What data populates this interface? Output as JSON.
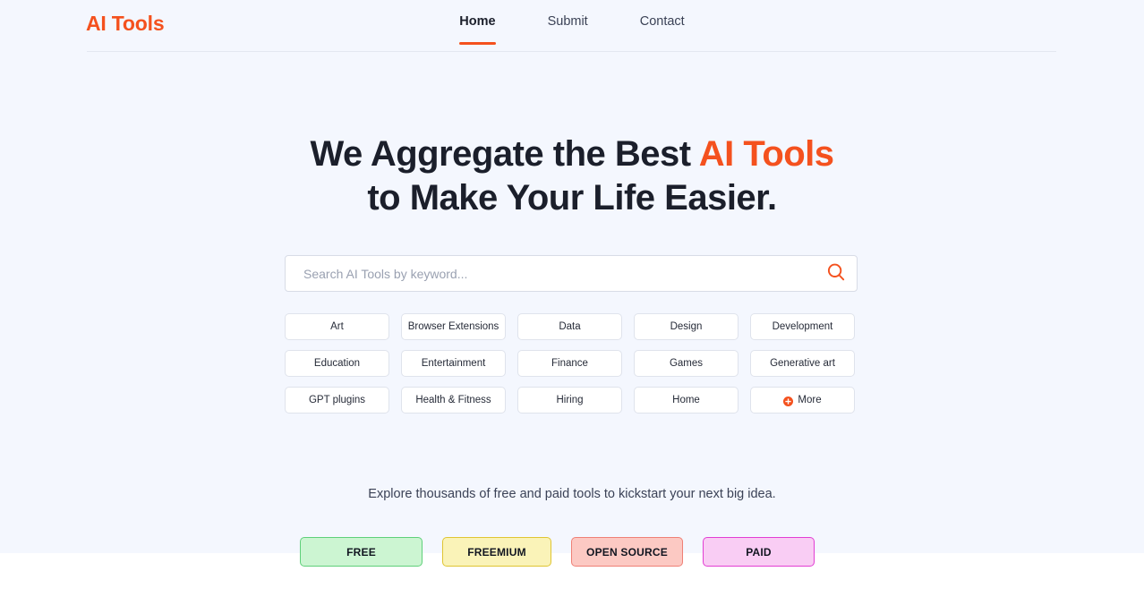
{
  "header": {
    "logo": "AI Tools",
    "logo_color": "#f4511e",
    "nav": [
      {
        "label": "Home",
        "active": true
      },
      {
        "label": "Submit",
        "active": false
      },
      {
        "label": "Contact",
        "active": false
      }
    ]
  },
  "hero": {
    "line1_plain": "We Aggregate the Best ",
    "line1_accent": "AI Tools",
    "line2": "to Make Your Life Easier.",
    "accent_color": "#f4511e"
  },
  "search": {
    "placeholder": "Search AI Tools by keyword...",
    "value": "",
    "icon": "search-icon",
    "icon_color": "#f4511e"
  },
  "categories": [
    {
      "label": "Art"
    },
    {
      "label": "Browser Extensions"
    },
    {
      "label": "Data"
    },
    {
      "label": "Design"
    },
    {
      "label": "Development"
    },
    {
      "label": "Education"
    },
    {
      "label": "Entertainment"
    },
    {
      "label": "Finance"
    },
    {
      "label": "Games"
    },
    {
      "label": "Generative art"
    },
    {
      "label": "GPT plugins"
    },
    {
      "label": "Health & Fitness"
    },
    {
      "label": "Hiring"
    },
    {
      "label": "Home"
    },
    {
      "label": "More",
      "icon": "plus-circle-icon",
      "icon_color": "#f4511e"
    }
  ],
  "tagline": "Explore thousands of free and paid tools to kickstart your next big idea.",
  "pricing_pills": [
    {
      "label": "FREE",
      "bg": "#ccf5d2",
      "border": "#5fd07a"
    },
    {
      "label": "FREEMIUM",
      "bg": "#faf3b8",
      "border": "#dfc533"
    },
    {
      "label": "OPEN SOURCE",
      "bg": "#fcc9c3",
      "border": "#ef8076"
    },
    {
      "label": "PAID",
      "bg": "#f9cdf4",
      "border": "#e23fd3"
    }
  ],
  "theme": {
    "page_bg": "#f4f7fe",
    "accent": "#f4511e",
    "text": "#1b1f2b"
  }
}
